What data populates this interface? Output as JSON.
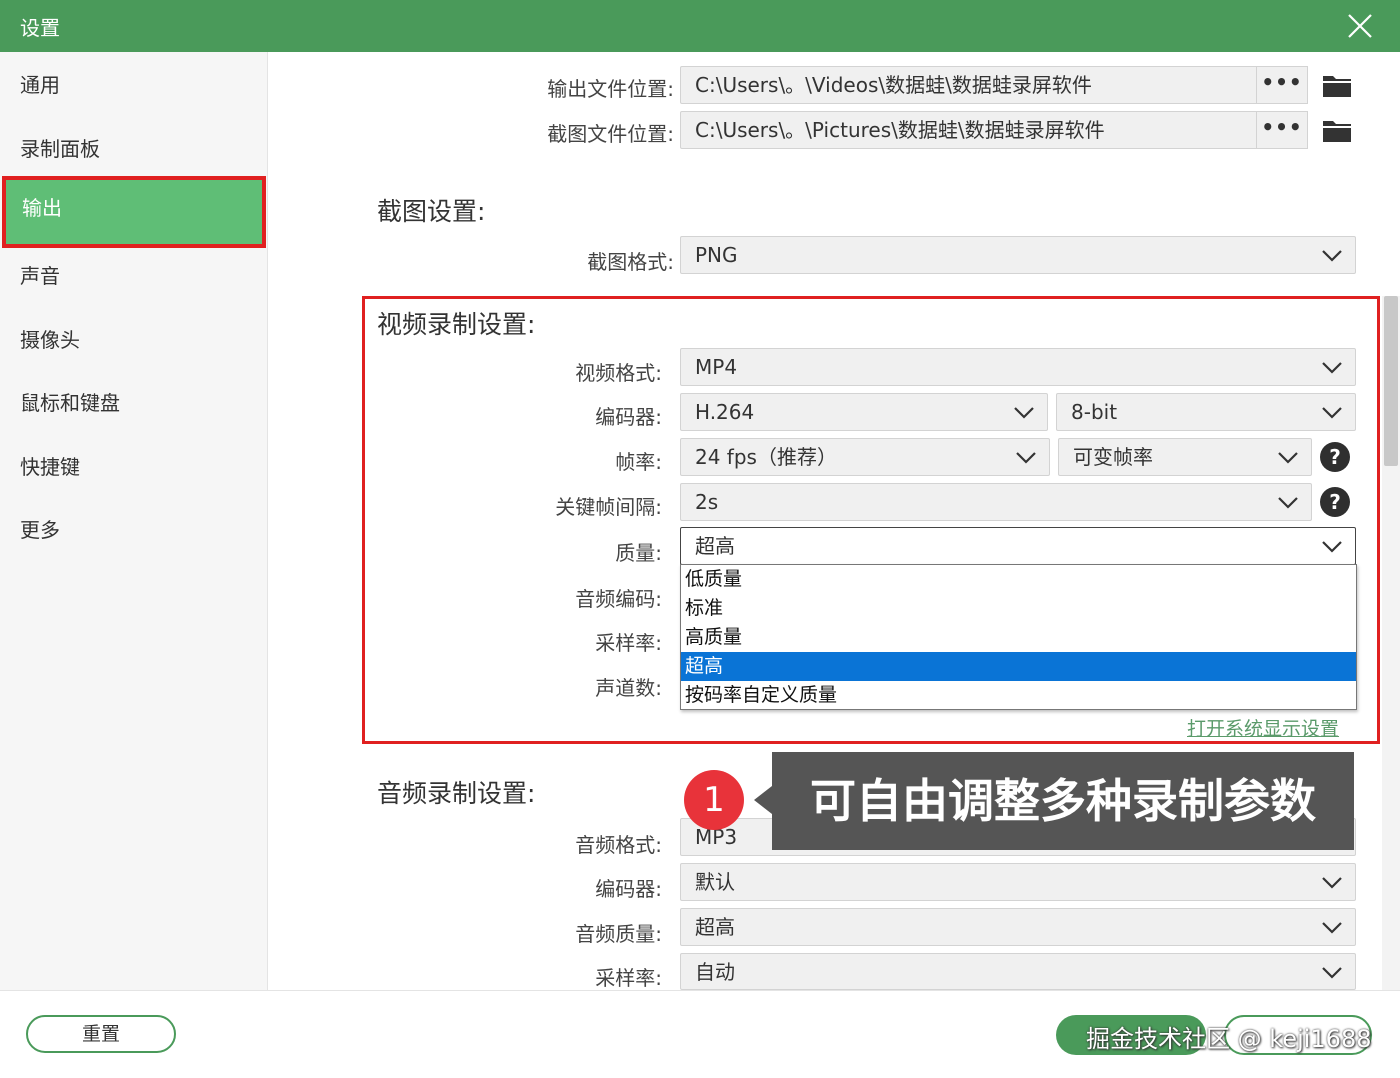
{
  "window": {
    "title": "设置"
  },
  "sidebar": {
    "items": [
      {
        "label": "通用"
      },
      {
        "label": "录制面板"
      },
      {
        "label": "输出"
      },
      {
        "label": "声音"
      },
      {
        "label": "摄像头"
      },
      {
        "label": "鼠标和键盘"
      },
      {
        "label": "快捷键"
      },
      {
        "label": "更多"
      }
    ],
    "active_label": "输出"
  },
  "output": {
    "file_location_label": "输出文件位置:",
    "file_location_value": "C:\\Users\\。\\Videos\\数据蛙\\数据蛙录屏软件",
    "screenshot_location_label": "截图文件位置:",
    "screenshot_location_value": "C:\\Users\\。\\Pictures\\数据蛙\\数据蛙录屏软件",
    "browse_label": "•••"
  },
  "screenshot_settings": {
    "title": "截图设置:",
    "format_label": "截图格式:",
    "format_value": "PNG"
  },
  "video_settings": {
    "title": "视频录制设置:",
    "format_label": "视频格式:",
    "format_value": "MP4",
    "encoder_label": "编码器:",
    "encoder_value": "H.264",
    "bitdepth_value": "8-bit",
    "framerate_label": "帧率:",
    "framerate_value": "24 fps（推荐）",
    "framerate_mode_value": "可变帧率",
    "keyframe_label": "关键帧间隔:",
    "keyframe_value": "2s",
    "quality_label": "质量:",
    "quality_value": "超高",
    "audio_codec_label": "音频编码:",
    "sample_rate_label": "采样率:",
    "channels_label": "声道数:",
    "quality_options": [
      "低质量",
      "标准",
      "高质量",
      "超高",
      "按码率自定义质量"
    ],
    "quality_selected_index": 3,
    "display_settings_link": "打开系统显示设置"
  },
  "audio_settings": {
    "title": "音频录制设置:",
    "format_label": "音频格式:",
    "format_value": "MP3",
    "encoder_label": "编码器:",
    "encoder_value": "默认",
    "quality_label": "音频质量:",
    "quality_value": "超高",
    "sample_rate_label": "采样率:",
    "sample_rate_value": "自动"
  },
  "annotation": {
    "badge_number": "1",
    "callout_text": "可自由调整多种录制参数"
  },
  "footer": {
    "reset_label": "重置",
    "watermark": "掘金技术社区 @ keji1688"
  },
  "colors": {
    "brand_green": "#4a9a5a",
    "active_green": "#5fbe76",
    "highlight_red": "#e02020",
    "selection_blue": "#0a74d6"
  }
}
